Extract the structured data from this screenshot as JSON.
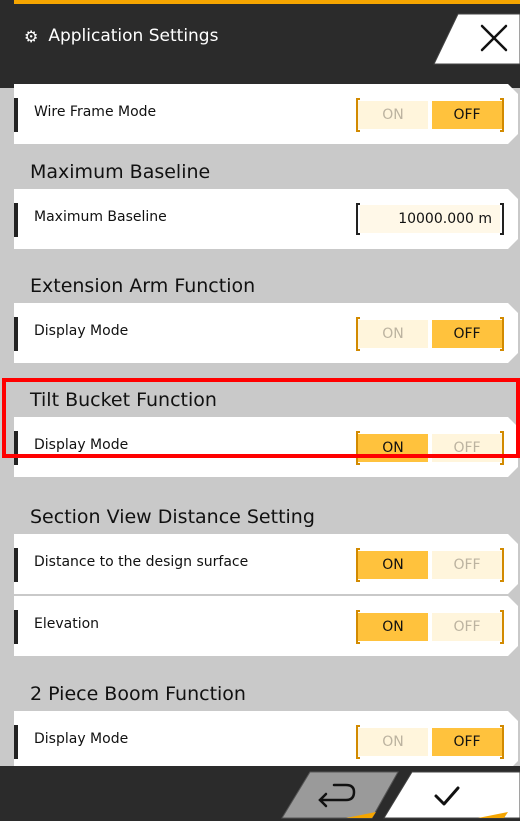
{
  "header": {
    "title": "Application Settings",
    "gear_icon": "gear-icon",
    "close_icon": "close-icon"
  },
  "rows": {
    "wire_frame": {
      "label": "Wire Frame Mode",
      "on": "ON",
      "off": "OFF",
      "state": "OFF"
    },
    "max_baseline_section": "Maximum Baseline",
    "max_baseline": {
      "label": "Maximum Baseline",
      "value": "10000.000 m"
    },
    "extension_section": "Extension Arm Function",
    "extension": {
      "label": "Display Mode",
      "on": "ON",
      "off": "OFF",
      "state": "OFF"
    },
    "tilt_section": "Tilt Bucket Function",
    "tilt": {
      "label": "Display Mode",
      "on": "ON",
      "off": "OFF",
      "state": "ON"
    },
    "section_view_section": "Section View Distance Setting",
    "distance_design": {
      "label": "Distance to the design surface",
      "on": "ON",
      "off": "OFF",
      "state": "ON"
    },
    "elevation": {
      "label": "Elevation",
      "on": "ON",
      "off": "OFF",
      "state": "ON"
    },
    "boom_section": "2 Piece Boom Function",
    "boom": {
      "label": "Display Mode",
      "on": "ON",
      "off": "OFF",
      "state": "OFF"
    }
  },
  "footer": {
    "back_icon": "return-icon",
    "confirm_icon": "checkmark-icon"
  },
  "colors": {
    "accent": "#f5a500",
    "toggle_active": "#ffc23d",
    "highlight": "#ff0000"
  }
}
